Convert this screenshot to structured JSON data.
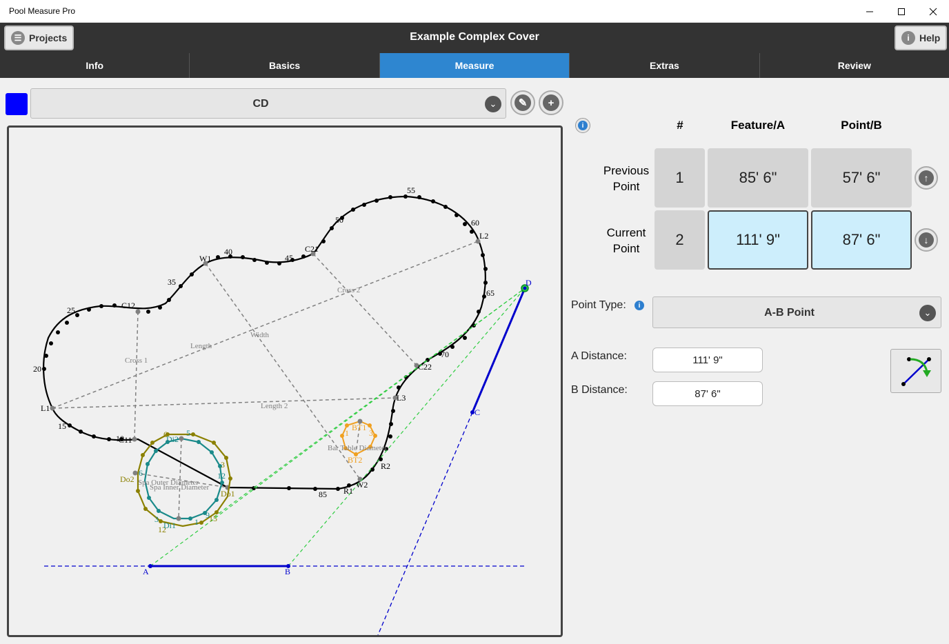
{
  "window": {
    "title": "Pool Measure Pro"
  },
  "header": {
    "projects_label": "Projects",
    "app_title": "Example Complex Cover",
    "help_label": "Help"
  },
  "tabs": [
    {
      "label": "Info"
    },
    {
      "label": "Basics"
    },
    {
      "label": "Measure"
    },
    {
      "label": "Extras"
    },
    {
      "label": "Review"
    }
  ],
  "feature": {
    "selected": "CD",
    "color": "#0000ff"
  },
  "table": {
    "headers": {
      "num": "#",
      "a": "Feature/A",
      "b": "Point/B"
    },
    "previous": {
      "label": "Previous Point",
      "num": "1",
      "a": "85' 6\"",
      "b": "57' 6\""
    },
    "current": {
      "label": "Current Point",
      "num": "2",
      "a": "111' 9\"",
      "b": "87' 6\""
    }
  },
  "point_type": {
    "label": "Point Type:",
    "value": "A-B Point"
  },
  "a_distance": {
    "label": "A Distance:",
    "value": "111' 9\""
  },
  "b_distance": {
    "label": "B Distance:",
    "value": "87' 6\""
  },
  "diagram_labels": {
    "c12": "C12",
    "w1": "W1",
    "c21": "C21",
    "l2": "L2",
    "l1": "L1",
    "l3": "L3",
    "c22": "C22",
    "r1": "R1",
    "r2": "R2",
    "w2": "W2",
    "c11": "C11",
    "n20": "20",
    "n25": "25",
    "n35": "35",
    "n40": "40",
    "n45": "45",
    "n50": "50",
    "n55": "55",
    "n60": "60",
    "n65": "65",
    "n70": "70",
    "n85": "85",
    "n10": "10",
    "n15": "15",
    "cross1": "Cross 1",
    "cross2": "Cross 2",
    "length": "Length",
    "width": "Width",
    "length2": "Length 2",
    "bar_table": "Bar Table Diameter",
    "bt1": "BT1",
    "bt2": "BT2",
    "b1": "1",
    "b3": "3",
    "spa_outer": "Spa Outer Diameter",
    "spa_inner": "Spa Inner Diameter",
    "di1": "Di1",
    "di2": "Di2",
    "do1": "Do1",
    "do2": "Do2",
    "s5": "5",
    "s6": "6",
    "s12": "12",
    "s3": "3",
    "s1": "1",
    "s15": "15",
    "s12b": "12",
    "s3b": "3",
    "s6b": "6",
    "s9": "9",
    "pa": "A",
    "pb": "B",
    "pc": "C",
    "pd": "D"
  }
}
